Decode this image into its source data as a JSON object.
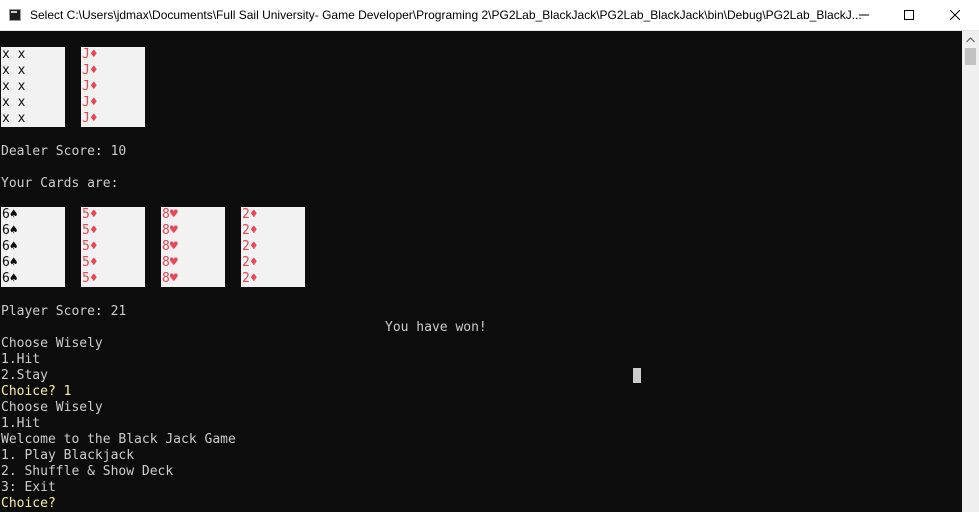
{
  "window": {
    "title": "Select C:\\Users\\jdmax\\Documents\\Full Sail University- Game Developer\\Programing 2\\PG2Lab_BlackJack\\PG2Lab_BlackJack\\bin\\Debug\\PG2Lab_BlackJ...",
    "icons": {
      "app": "console-icon",
      "minimize": "minimize-icon",
      "maximize": "maximize-icon",
      "close": "close-icon",
      "scroll_up": "chevron-up-icon"
    }
  },
  "colors": {
    "background": "#0c0c0c",
    "text": "#cccccc",
    "prompt": "#f9f1a5",
    "card_face": "#f2f2f2",
    "red_suit": "#e74856",
    "black_suit": "#0c0c0c"
  },
  "dealer": {
    "cards": [
      {
        "label": "x x",
        "suit_color": "black"
      },
      {
        "label": "J♦",
        "suit_color": "red"
      }
    ],
    "score_line": "Dealer Score: 10"
  },
  "player": {
    "heading": "Your Cards are:",
    "cards": [
      {
        "label": "6♠",
        "suit_color": "black"
      },
      {
        "label": "5♦",
        "suit_color": "red"
      },
      {
        "label": "8♥",
        "suit_color": "red"
      },
      {
        "label": "2♦",
        "suit_color": "red"
      }
    ],
    "score_line": "Player Score: 21"
  },
  "result": "You have won!",
  "lines": [
    {
      "text": "Choose Wisely",
      "style": "normal"
    },
    {
      "text": "1.Hit",
      "style": "normal"
    },
    {
      "text": "2.Stay",
      "style": "normal"
    },
    {
      "text": "Choice? 1",
      "style": "prompt"
    },
    {
      "text": "Choose Wisely",
      "style": "normal"
    },
    {
      "text": "1.Hit",
      "style": "normal"
    },
    {
      "text": "Welcome to the Black Jack Game",
      "style": "normal"
    },
    {
      "text": "1. Play Blackjack",
      "style": "normal"
    },
    {
      "text": "2. Shuffle & Show Deck",
      "style": "normal"
    },
    {
      "text": "3: Exit",
      "style": "normal"
    },
    {
      "text": "Choice?",
      "style": "prompt"
    }
  ]
}
